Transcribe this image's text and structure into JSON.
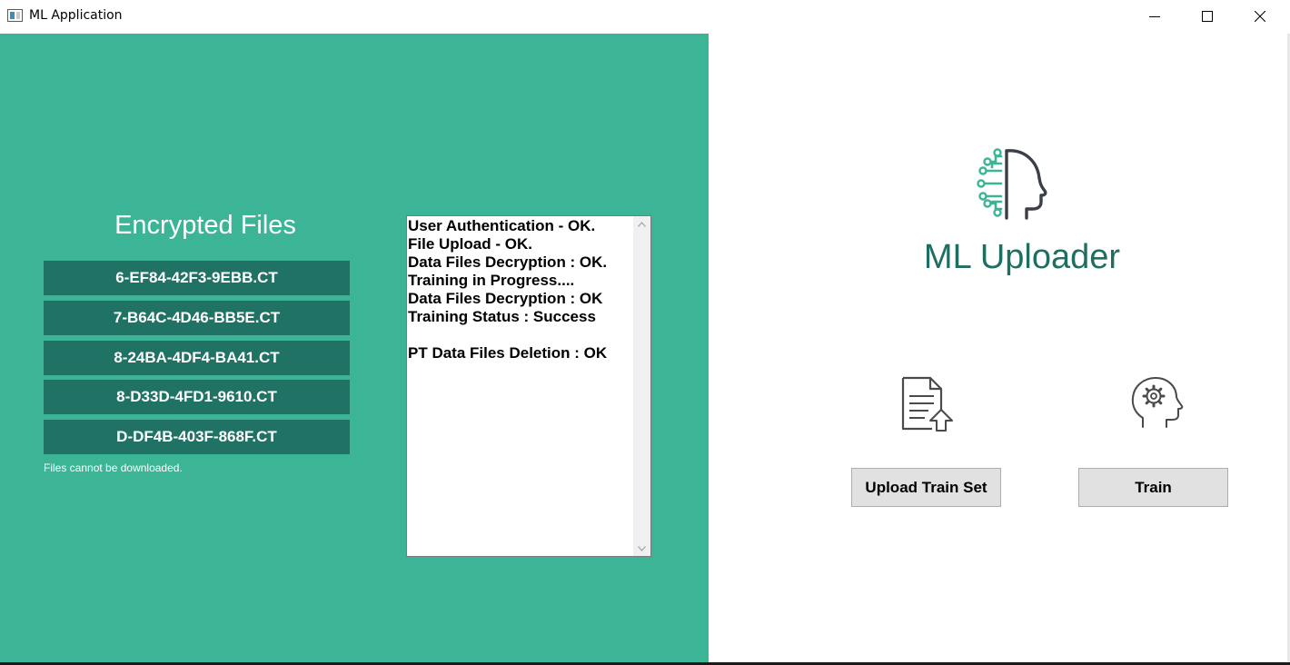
{
  "window": {
    "title": "ML Application",
    "controls": [
      "minimize-icon",
      "maximize-icon",
      "close-icon"
    ]
  },
  "encrypted_files": {
    "heading": "Encrypted Files",
    "items": [
      "6-EF84-42F3-9EBB.CT",
      "7-B64C-4D46-BB5E.CT",
      "8-24BA-4DF4-BA41.CT",
      "8-D33D-4FD1-9610.CT",
      "D-DF4B-403F-868F.CT"
    ],
    "note": "Files cannot be downloaded."
  },
  "log": {
    "lines": [
      "User Authentication - OK.",
      "File Upload - OK.",
      "Data Files Decryption : OK.",
      "Training in Progress....",
      "Data Files Decryption : OK",
      "Training Status : Success",
      "",
      "PT Data Files Deletion : OK"
    ]
  },
  "brand": {
    "name": "ML Uploader",
    "logo_icon": "ai-brain-head-icon"
  },
  "actions": {
    "upload_label": "Upload Train Set",
    "upload_icon": "document-upload-icon",
    "train_label": "Train",
    "train_icon": "head-gear-icon"
  },
  "colors": {
    "left_background": "#3cb496",
    "file_button": "#207364",
    "brand_text": "#1e6f62",
    "action_button": "#e1e1e1"
  }
}
